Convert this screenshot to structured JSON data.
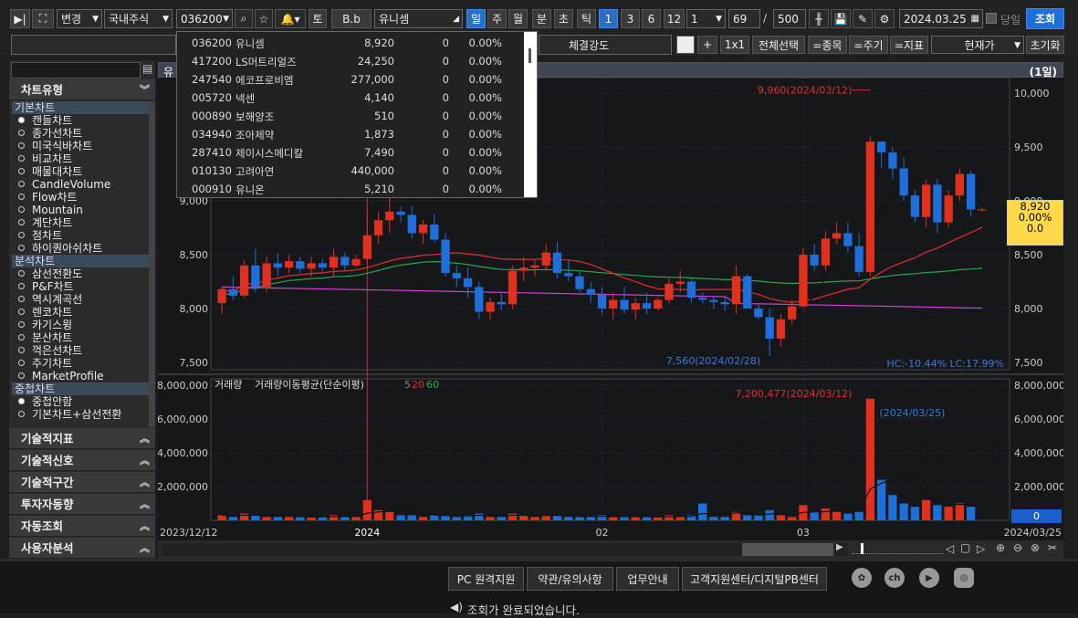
{
  "toolbar": {
    "change_label": "변경",
    "market": "국내주식",
    "code": "036200",
    "t_label": "토",
    "bb_label": "B.b",
    "stock_name": "유니셈",
    "periods": [
      "일",
      "주",
      "월",
      "분",
      "초",
      "틱"
    ],
    "nums": [
      "1",
      "3",
      "6",
      "12"
    ],
    "interval_value": "1",
    "count_value": "69",
    "slash": "/",
    "max_value": "500",
    "date": "2024.03.25",
    "today_label": "당일",
    "query_label": "조회"
  },
  "toolbar2": {
    "strength_label": "체결강도",
    "plus": "+",
    "one_by_one": "1x1",
    "select_all": "전체선택",
    "by_item": "=종목",
    "by_period": "=주기",
    "by_indicator": "=지표",
    "price_select": "현재가",
    "reset": "초기화"
  },
  "sidebar": {
    "chart_type_title": "차트유형",
    "sections": [
      {
        "title": "기본차트",
        "items": [
          "캔들차트",
          "종가선차트",
          "미국식바차트",
          "비교차트",
          "매물대차트",
          "CandleVolume",
          "Flow차트",
          "Mountain",
          "계단차트",
          "점차트",
          "하이퀀아쉬차트"
        ]
      },
      {
        "title": "분석차트",
        "items": [
          "삼선전환도",
          "P&F차트",
          "역시계곡선",
          "렌코차트",
          "카기스윙",
          "분산차트",
          "꺽은선차트",
          "주기차트",
          "MarketProfile"
        ]
      },
      {
        "title": "중첩차트",
        "items": [
          "중첩안함",
          "기본차트+삼선전환"
        ]
      }
    ],
    "panels": [
      "기술적지표",
      "기술적신호",
      "기술적구간",
      "투자자동향",
      "자동조회",
      "사용자분석"
    ]
  },
  "dropdown": {
    "rows": [
      {
        "code": "036200",
        "name": "유니셈",
        "price": "8,920",
        "chg": "0",
        "pct": "0.00%"
      },
      {
        "code": "417200",
        "name": "LS머트리얼즈",
        "price": "24,250",
        "chg": "0",
        "pct": "0.00%"
      },
      {
        "code": "247540",
        "name": "에코프로비엠",
        "price": "277,000",
        "chg": "0",
        "pct": "0.00%"
      },
      {
        "code": "005720",
        "name": "넥센",
        "price": "4,140",
        "chg": "0",
        "pct": "0.00%"
      },
      {
        "code": "000890",
        "name": "보해양조",
        "price": "510",
        "chg": "0",
        "pct": "0.00%"
      },
      {
        "code": "034940",
        "name": "조아제약",
        "price": "1,873",
        "chg": "0",
        "pct": "0.00%"
      },
      {
        "code": "287410",
        "name": "제이시스메디칼",
        "price": "7,490",
        "chg": "0",
        "pct": "0.00%"
      },
      {
        "code": "010130",
        "name": "고려아연",
        "price": "440,000",
        "chg": "0",
        "pct": "0.00%"
      },
      {
        "code": "000910",
        "name": "유니온",
        "price": "5,210",
        "chg": "0",
        "pct": "0.00%"
      }
    ]
  },
  "chart": {
    "title_stub": "유",
    "period_tag": "(1일)",
    "price_ticks": [
      "10,000",
      "9,500",
      "9,000",
      "8,500",
      "8,000",
      "7,500"
    ],
    "left_price_ticks": [
      "9,000",
      "8,500",
      "8,000",
      "7,500"
    ],
    "vol_ticks": [
      "8,000,000",
      "6,000,000",
      "4,000,000",
      "2,000,000"
    ],
    "right_vol_ticks": [
      "8,000,000",
      "6,000,000",
      "4,000,000",
      "2,000,000"
    ],
    "high_note": "9,960(2024/03/12)",
    "low_note": "7,560(2024/02/28)",
    "hc_lc": "HC:-10.44%  LC:17.99%",
    "vol_peak_note": "7,200,477(2024/03/12)",
    "vol_date_note": "(2024/03/25)",
    "vol_legend": "거래량",
    "vol_ma_legend": "거래량이동평균(단순이평)",
    "vol_ma_params": [
      "5",
      "20",
      "60"
    ],
    "price_tag": [
      "8,920",
      "0.00%",
      "0.0"
    ],
    "vol_tag": "0",
    "x_labels": {
      "start": "2023/12/12",
      "y2024": "2024",
      "feb": "02",
      "mar": "03",
      "end": "2024/03/25"
    }
  },
  "footer": {
    "buttons": [
      "PC 원격지원",
      "약관/유의사항",
      "업무안내",
      "고객지원센터/디지털PB센터"
    ],
    "social_icons": [
      "settings-icon",
      "ch-icon",
      "youtube-icon",
      "instagram-icon"
    ],
    "ch_text": "ch",
    "status": "조회가 완료되었습니다."
  },
  "chart_data": {
    "type": "candlestick",
    "x_range": [
      "2023/12/12",
      "2024/03/25"
    ],
    "price_ylim": [
      7500,
      10000
    ],
    "volume_ylim": [
      0,
      8000000
    ],
    "highlights": {
      "high": {
        "value": 9960,
        "date": "2024/03/12"
      },
      "low": {
        "value": 7560,
        "date": "2024/02/28"
      },
      "volume_peak": {
        "value": 7200477,
        "date": "2024/03/12"
      }
    },
    "last_close": 8920,
    "candles": [
      [
        8050,
        8200,
        7950,
        8180
      ],
      [
        8180,
        8300,
        8080,
        8120
      ],
      [
        8120,
        8450,
        8100,
        8400
      ],
      [
        8400,
        8550,
        8150,
        8200
      ],
      [
        8200,
        8480,
        8150,
        8420
      ],
      [
        8420,
        8520,
        8300,
        8380
      ],
      [
        8380,
        8500,
        8330,
        8440
      ],
      [
        8440,
        8480,
        8330,
        8370
      ],
      [
        8370,
        8480,
        8300,
        8420
      ],
      [
        8420,
        8460,
        8340,
        8380
      ],
      [
        8380,
        8550,
        8300,
        8480
      ],
      [
        8480,
        8520,
        8350,
        8400
      ],
      [
        8400,
        8500,
        8380,
        8460
      ],
      [
        8460,
        8900,
        8400,
        8680
      ],
      [
        8680,
        8900,
        8600,
        8820
      ],
      [
        8820,
        9050,
        8700,
        8900
      ],
      [
        8900,
        8950,
        8800,
        8870
      ],
      [
        8870,
        8950,
        8650,
        8700
      ],
      [
        8700,
        8820,
        8600,
        8780
      ],
      [
        8780,
        8880,
        8620,
        8640
      ],
      [
        8640,
        8700,
        8300,
        8330
      ],
      [
        8330,
        8400,
        8200,
        8280
      ],
      [
        8280,
        8380,
        8100,
        8200
      ],
      [
        8200,
        8250,
        7900,
        7970
      ],
      [
        7970,
        8100,
        7900,
        8060
      ],
      [
        8060,
        8150,
        7980,
        8040
      ],
      [
        8040,
        8400,
        8000,
        8350
      ],
      [
        8350,
        8480,
        8250,
        8380
      ],
      [
        8380,
        8450,
        8300,
        8400
      ],
      [
        8400,
        8600,
        8350,
        8520
      ],
      [
        8520,
        8620,
        8280,
        8330
      ],
      [
        8330,
        8450,
        8250,
        8300
      ],
      [
        8300,
        8350,
        8150,
        8180
      ],
      [
        8180,
        8250,
        8050,
        8130
      ],
      [
        8130,
        8200,
        7950,
        8000
      ],
      [
        8000,
        8150,
        7900,
        8080
      ],
      [
        8080,
        8200,
        7950,
        7990
      ],
      [
        7990,
        8100,
        7900,
        8050
      ],
      [
        8050,
        8150,
        7950,
        8000
      ],
      [
        8000,
        8100,
        7980,
        8080
      ],
      [
        8080,
        8280,
        8050,
        8230
      ],
      [
        8230,
        8350,
        8150,
        8250
      ],
      [
        8250,
        8280,
        8050,
        8100
      ],
      [
        8100,
        8150,
        8050,
        8080
      ],
      [
        8080,
        8120,
        8000,
        8060
      ],
      [
        8060,
        8120,
        7980,
        8040
      ],
      [
        8040,
        8400,
        7950,
        8300
      ],
      [
        8300,
        8320,
        8000,
        8000
      ],
      [
        8000,
        8050,
        7900,
        7920
      ],
      [
        7920,
        8000,
        7560,
        7720
      ],
      [
        7720,
        7950,
        7650,
        7900
      ],
      [
        7900,
        8080,
        7850,
        8020
      ],
      [
        8020,
        8560,
        8000,
        8500
      ],
      [
        8500,
        8600,
        8350,
        8400
      ],
      [
        8400,
        8720,
        8350,
        8650
      ],
      [
        8650,
        8800,
        8600,
        8700
      ],
      [
        8700,
        8800,
        8520,
        8580
      ],
      [
        8580,
        8700,
        8300,
        8340
      ],
      [
        8340,
        9600,
        8300,
        9550
      ],
      [
        9550,
        9550,
        9300,
        9450
      ],
      [
        9450,
        9500,
        9200,
        9300
      ],
      [
        9300,
        9400,
        9000,
        9050
      ],
      [
        9050,
        9100,
        8800,
        8850
      ],
      [
        8850,
        9200,
        8750,
        9150
      ],
      [
        9150,
        9200,
        8700,
        8800
      ],
      [
        8800,
        9100,
        8750,
        9050
      ],
      [
        9050,
        9300,
        9000,
        9250
      ],
      [
        9250,
        9280,
        8850,
        8920
      ],
      [
        8920,
        8940,
        8900,
        8920
      ]
    ],
    "volume_millions": [
      0.3,
      0.2,
      0.4,
      0.3,
      0.2,
      0.2,
      0.2,
      0.2,
      0.2,
      0.2,
      0.3,
      0.2,
      0.2,
      1.2,
      0.6,
      0.5,
      0.3,
      0.3,
      0.2,
      0.3,
      0.3,
      0.2,
      0.3,
      0.4,
      0.2,
      0.2,
      0.4,
      0.3,
      0.2,
      0.3,
      0.3,
      0.2,
      0.2,
      0.2,
      0.3,
      0.2,
      0.2,
      0.2,
      0.2,
      0.2,
      0.3,
      0.2,
      0.3,
      1.0,
      0.2,
      0.2,
      0.5,
      0.3,
      0.3,
      0.6,
      0.3,
      0.2,
      0.9,
      0.5,
      0.7,
      0.5,
      0.4,
      0.5,
      7.2,
      2.4,
      1.5,
      1.0,
      0.8,
      1.2,
      0.9,
      0.8,
      1.0,
      0.8,
      0.0
    ]
  }
}
